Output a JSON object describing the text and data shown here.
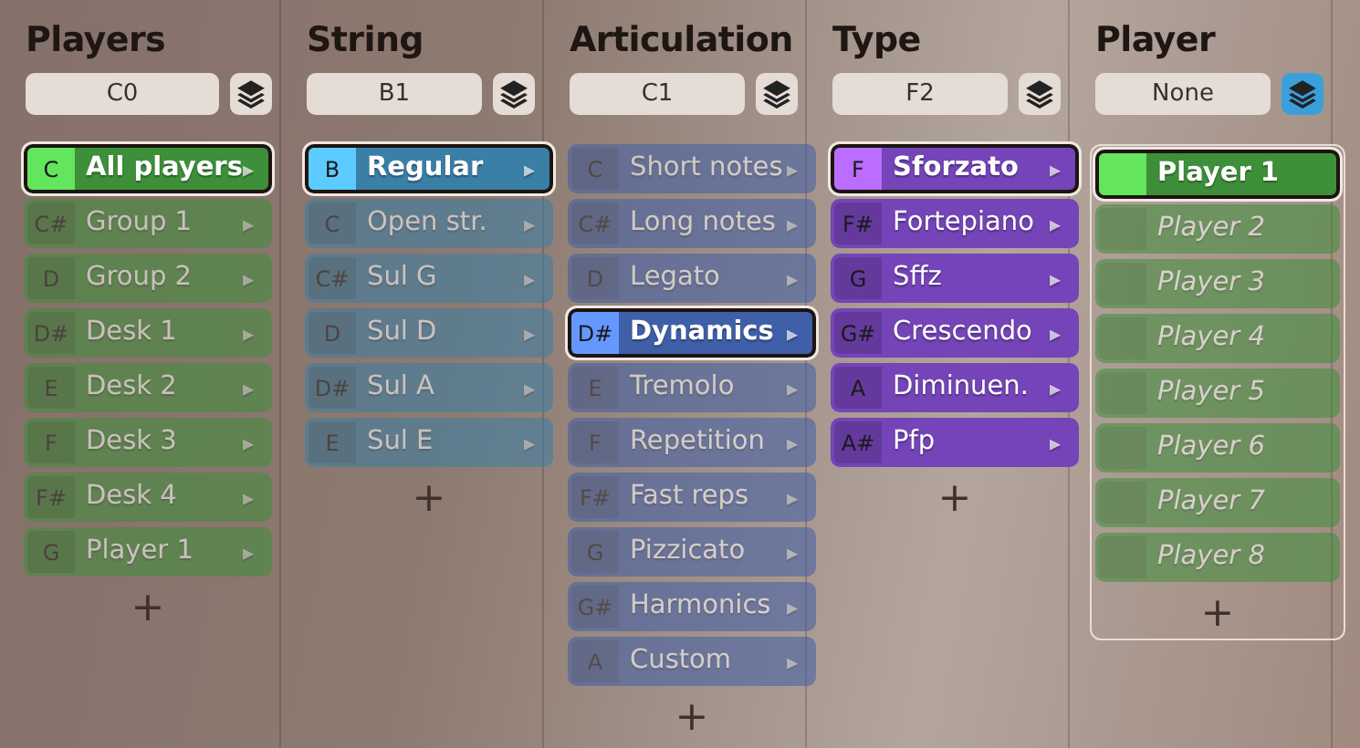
{
  "columns": [
    {
      "title": "Players",
      "key": "C0",
      "layers_on": false,
      "color": "#3e8f3a",
      "items": [
        {
          "key": "C",
          "label": "All players",
          "selected": true,
          "dimmed": false,
          "italic": false,
          "arrow": "▸"
        },
        {
          "key": "C#",
          "label": "Group 1",
          "selected": false,
          "dimmed": true,
          "italic": false,
          "arrow": "▸"
        },
        {
          "key": "D",
          "label": "Group 2",
          "selected": false,
          "dimmed": true,
          "italic": false,
          "arrow": "▸"
        },
        {
          "key": "D#",
          "label": "Desk 1",
          "selected": false,
          "dimmed": true,
          "italic": false,
          "arrow": "▸"
        },
        {
          "key": "E",
          "label": "Desk 2",
          "selected": false,
          "dimmed": true,
          "italic": false,
          "arrow": "▸"
        },
        {
          "key": "F",
          "label": "Desk 3",
          "selected": false,
          "dimmed": true,
          "italic": false,
          "arrow": "▸"
        },
        {
          "key": "F#",
          "label": "Desk 4",
          "selected": false,
          "dimmed": true,
          "italic": false,
          "arrow": "▸"
        },
        {
          "key": "G",
          "label": "Player 1",
          "selected": false,
          "dimmed": true,
          "italic": false,
          "arrow": "▸"
        }
      ],
      "add": "+"
    },
    {
      "title": "String",
      "key": "B1",
      "layers_on": false,
      "color": "#3a7fa6",
      "items": [
        {
          "key": "B",
          "label": "Regular",
          "selected": true,
          "dimmed": false,
          "italic": false,
          "arrow": "▸"
        },
        {
          "key": "C",
          "label": "Open str.",
          "selected": false,
          "dimmed": true,
          "italic": false,
          "arrow": "▸"
        },
        {
          "key": "C#",
          "label": "Sul G",
          "selected": false,
          "dimmed": true,
          "italic": false,
          "arrow": "▸"
        },
        {
          "key": "D",
          "label": "Sul D",
          "selected": false,
          "dimmed": true,
          "italic": false,
          "arrow": "▸"
        },
        {
          "key": "D#",
          "label": "Sul A",
          "selected": false,
          "dimmed": true,
          "italic": false,
          "arrow": "▸"
        },
        {
          "key": "E",
          "label": "Sul E",
          "selected": false,
          "dimmed": true,
          "italic": false,
          "arrow": "▸"
        }
      ],
      "add": "+"
    },
    {
      "title": "Articulation",
      "key": "C1",
      "layers_on": false,
      "color": "#3f5fa8",
      "items": [
        {
          "key": "C",
          "label": "Short notes",
          "selected": false,
          "dimmed": true,
          "italic": false,
          "arrow": "▸"
        },
        {
          "key": "C#",
          "label": "Long notes",
          "selected": false,
          "dimmed": true,
          "italic": false,
          "arrow": "▸"
        },
        {
          "key": "D",
          "label": "Legato",
          "selected": false,
          "dimmed": true,
          "italic": false,
          "arrow": "▸"
        },
        {
          "key": "D#",
          "label": "Dynamics",
          "selected": true,
          "dimmed": false,
          "italic": false,
          "arrow": "▸"
        },
        {
          "key": "E",
          "label": "Tremolo",
          "selected": false,
          "dimmed": true,
          "italic": false,
          "arrow": "▸"
        },
        {
          "key": "F",
          "label": "Repetition",
          "selected": false,
          "dimmed": true,
          "italic": false,
          "arrow": "▸"
        },
        {
          "key": "F#",
          "label": "Fast reps",
          "selected": false,
          "dimmed": true,
          "italic": false,
          "arrow": "▸"
        },
        {
          "key": "G",
          "label": "Pizzicato",
          "selected": false,
          "dimmed": true,
          "italic": false,
          "arrow": "▸"
        },
        {
          "key": "G#",
          "label": "Harmonics",
          "selected": false,
          "dimmed": true,
          "italic": false,
          "arrow": "▸"
        },
        {
          "key": "A",
          "label": "Custom",
          "selected": false,
          "dimmed": true,
          "italic": false,
          "arrow": "▸"
        }
      ],
      "add": "+"
    },
    {
      "title": "Type",
      "key": "F2",
      "layers_on": false,
      "color": "#7444b8",
      "items": [
        {
          "key": "F",
          "label": "Sforzato",
          "selected": true,
          "dimmed": false,
          "italic": false,
          "arrow": "▸"
        },
        {
          "key": "F#",
          "label": "Fortepiano",
          "selected": false,
          "dimmed": false,
          "italic": false,
          "arrow": "▸"
        },
        {
          "key": "G",
          "label": "Sffz",
          "selected": false,
          "dimmed": false,
          "italic": false,
          "arrow": "▸"
        },
        {
          "key": "G#",
          "label": "Crescendo",
          "selected": false,
          "dimmed": false,
          "italic": false,
          "arrow": "▸"
        },
        {
          "key": "A",
          "label": "Diminuen.",
          "selected": false,
          "dimmed": false,
          "italic": false,
          "arrow": "▸"
        },
        {
          "key": "A#",
          "label": "Pfp",
          "selected": false,
          "dimmed": false,
          "italic": false,
          "arrow": "▸"
        }
      ],
      "add": "+"
    },
    {
      "title": "Player",
      "key": "None",
      "layers_on": true,
      "color": "#3e8f3a",
      "items": [
        {
          "label": "Player 1",
          "selected": true,
          "dimmed": false,
          "italic": false
        },
        {
          "label": "Player 2",
          "selected": false,
          "dimmed": true,
          "italic": true
        },
        {
          "label": "Player 3",
          "selected": false,
          "dimmed": true,
          "italic": true
        },
        {
          "label": "Player 4",
          "selected": false,
          "dimmed": true,
          "italic": true
        },
        {
          "label": "Player 5",
          "selected": false,
          "dimmed": true,
          "italic": true
        },
        {
          "label": "Player 6",
          "selected": false,
          "dimmed": true,
          "italic": true
        },
        {
          "label": "Player 7",
          "selected": false,
          "dimmed": true,
          "italic": true
        },
        {
          "label": "Player 8",
          "selected": false,
          "dimmed": true,
          "italic": true
        }
      ],
      "add": "+"
    }
  ]
}
